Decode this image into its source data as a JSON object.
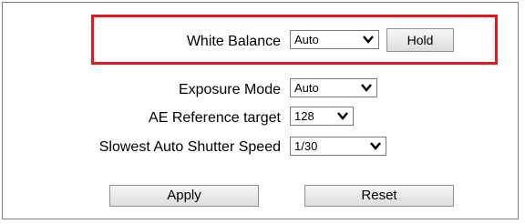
{
  "white_balance": {
    "label": "White Balance",
    "value": "Auto",
    "hold_label": "Hold"
  },
  "exposure_mode": {
    "label": "Exposure Mode",
    "value": "Auto"
  },
  "ae_reference_target": {
    "label": "AE Reference target",
    "value": "128"
  },
  "slowest_shutter": {
    "label": "Slowest Auto Shutter Speed",
    "value": "1/30"
  },
  "actions": {
    "apply_label": "Apply",
    "reset_label": "Reset"
  },
  "colors": {
    "highlight": "#e8151c"
  }
}
